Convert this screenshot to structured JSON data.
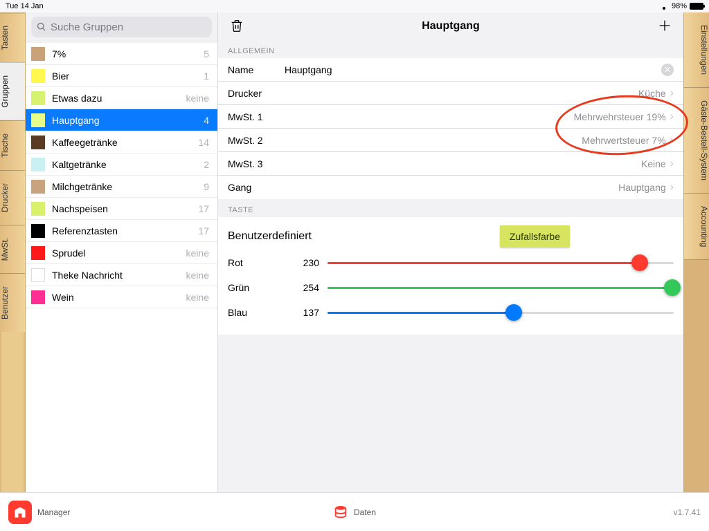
{
  "status": {
    "date": "Tue 14 Jan",
    "battery": "98%"
  },
  "left_tabs": [
    "Tasten",
    "Gruppen",
    "Tische",
    "Drucker",
    "MwSt.",
    "Benutzer"
  ],
  "left_active": 1,
  "right_tabs": [
    "Einstellungen",
    "Gäste-Bestell-System",
    "Accounting"
  ],
  "search_placeholder": "Suche Gruppen",
  "groups": [
    {
      "name": "7%",
      "count": "5",
      "color": "#caa27a"
    },
    {
      "name": "Bier",
      "count": "1",
      "color": "#fff94f"
    },
    {
      "name": "Etwas dazu",
      "count": "keine",
      "color": "#d6f26e"
    },
    {
      "name": "Hauptgang",
      "count": "4",
      "color": "#e6fe89",
      "selected": true
    },
    {
      "name": "Kaffeegetränke",
      "count": "14",
      "color": "#5a3a22"
    },
    {
      "name": "Kaltgetränke",
      "count": "2",
      "color": "#c9f0f2"
    },
    {
      "name": "Milchgetränke",
      "count": "9",
      "color": "#c9a27e"
    },
    {
      "name": "Nachspeisen",
      "count": "17",
      "color": "#d9f06a"
    },
    {
      "name": "Referenztasten",
      "count": "17",
      "color": "#000000"
    },
    {
      "name": "Sprudel",
      "count": "keine",
      "color": "#ff1a1a"
    },
    {
      "name": "Theke Nachricht",
      "count": "keine",
      "color": "#ffffff"
    },
    {
      "name": "Wein",
      "count": "keine",
      "color": "#ff2e92"
    }
  ],
  "detail": {
    "title": "Hauptgang",
    "section1": "ALLGEMEIN",
    "name_label": "Name",
    "name_value": "Hauptgang",
    "rows": [
      {
        "label": "Drucker",
        "value": "Küche"
      },
      {
        "label": "MwSt. 1",
        "value": "Mehrwehrsteuer 19%"
      },
      {
        "label": "MwSt. 2",
        "value": "Mehrwertsteuer 7%"
      },
      {
        "label": "MwSt. 3",
        "value": "Keine"
      },
      {
        "label": "Gang",
        "value": "Hauptgang"
      }
    ],
    "section2": "TASTE",
    "custom_label": "Benutzerdefiniert",
    "random_label": "Zufallsfarbe",
    "sliders": [
      {
        "name": "Rot",
        "value": 230,
        "color": "#ff3b30"
      },
      {
        "name": "Grün",
        "value": 254,
        "color": "#34c759"
      },
      {
        "name": "Blau",
        "value": 137,
        "color": "#007aff"
      }
    ]
  },
  "bottom": {
    "app": "Manager",
    "data": "Daten",
    "version": "v1.7.41"
  }
}
